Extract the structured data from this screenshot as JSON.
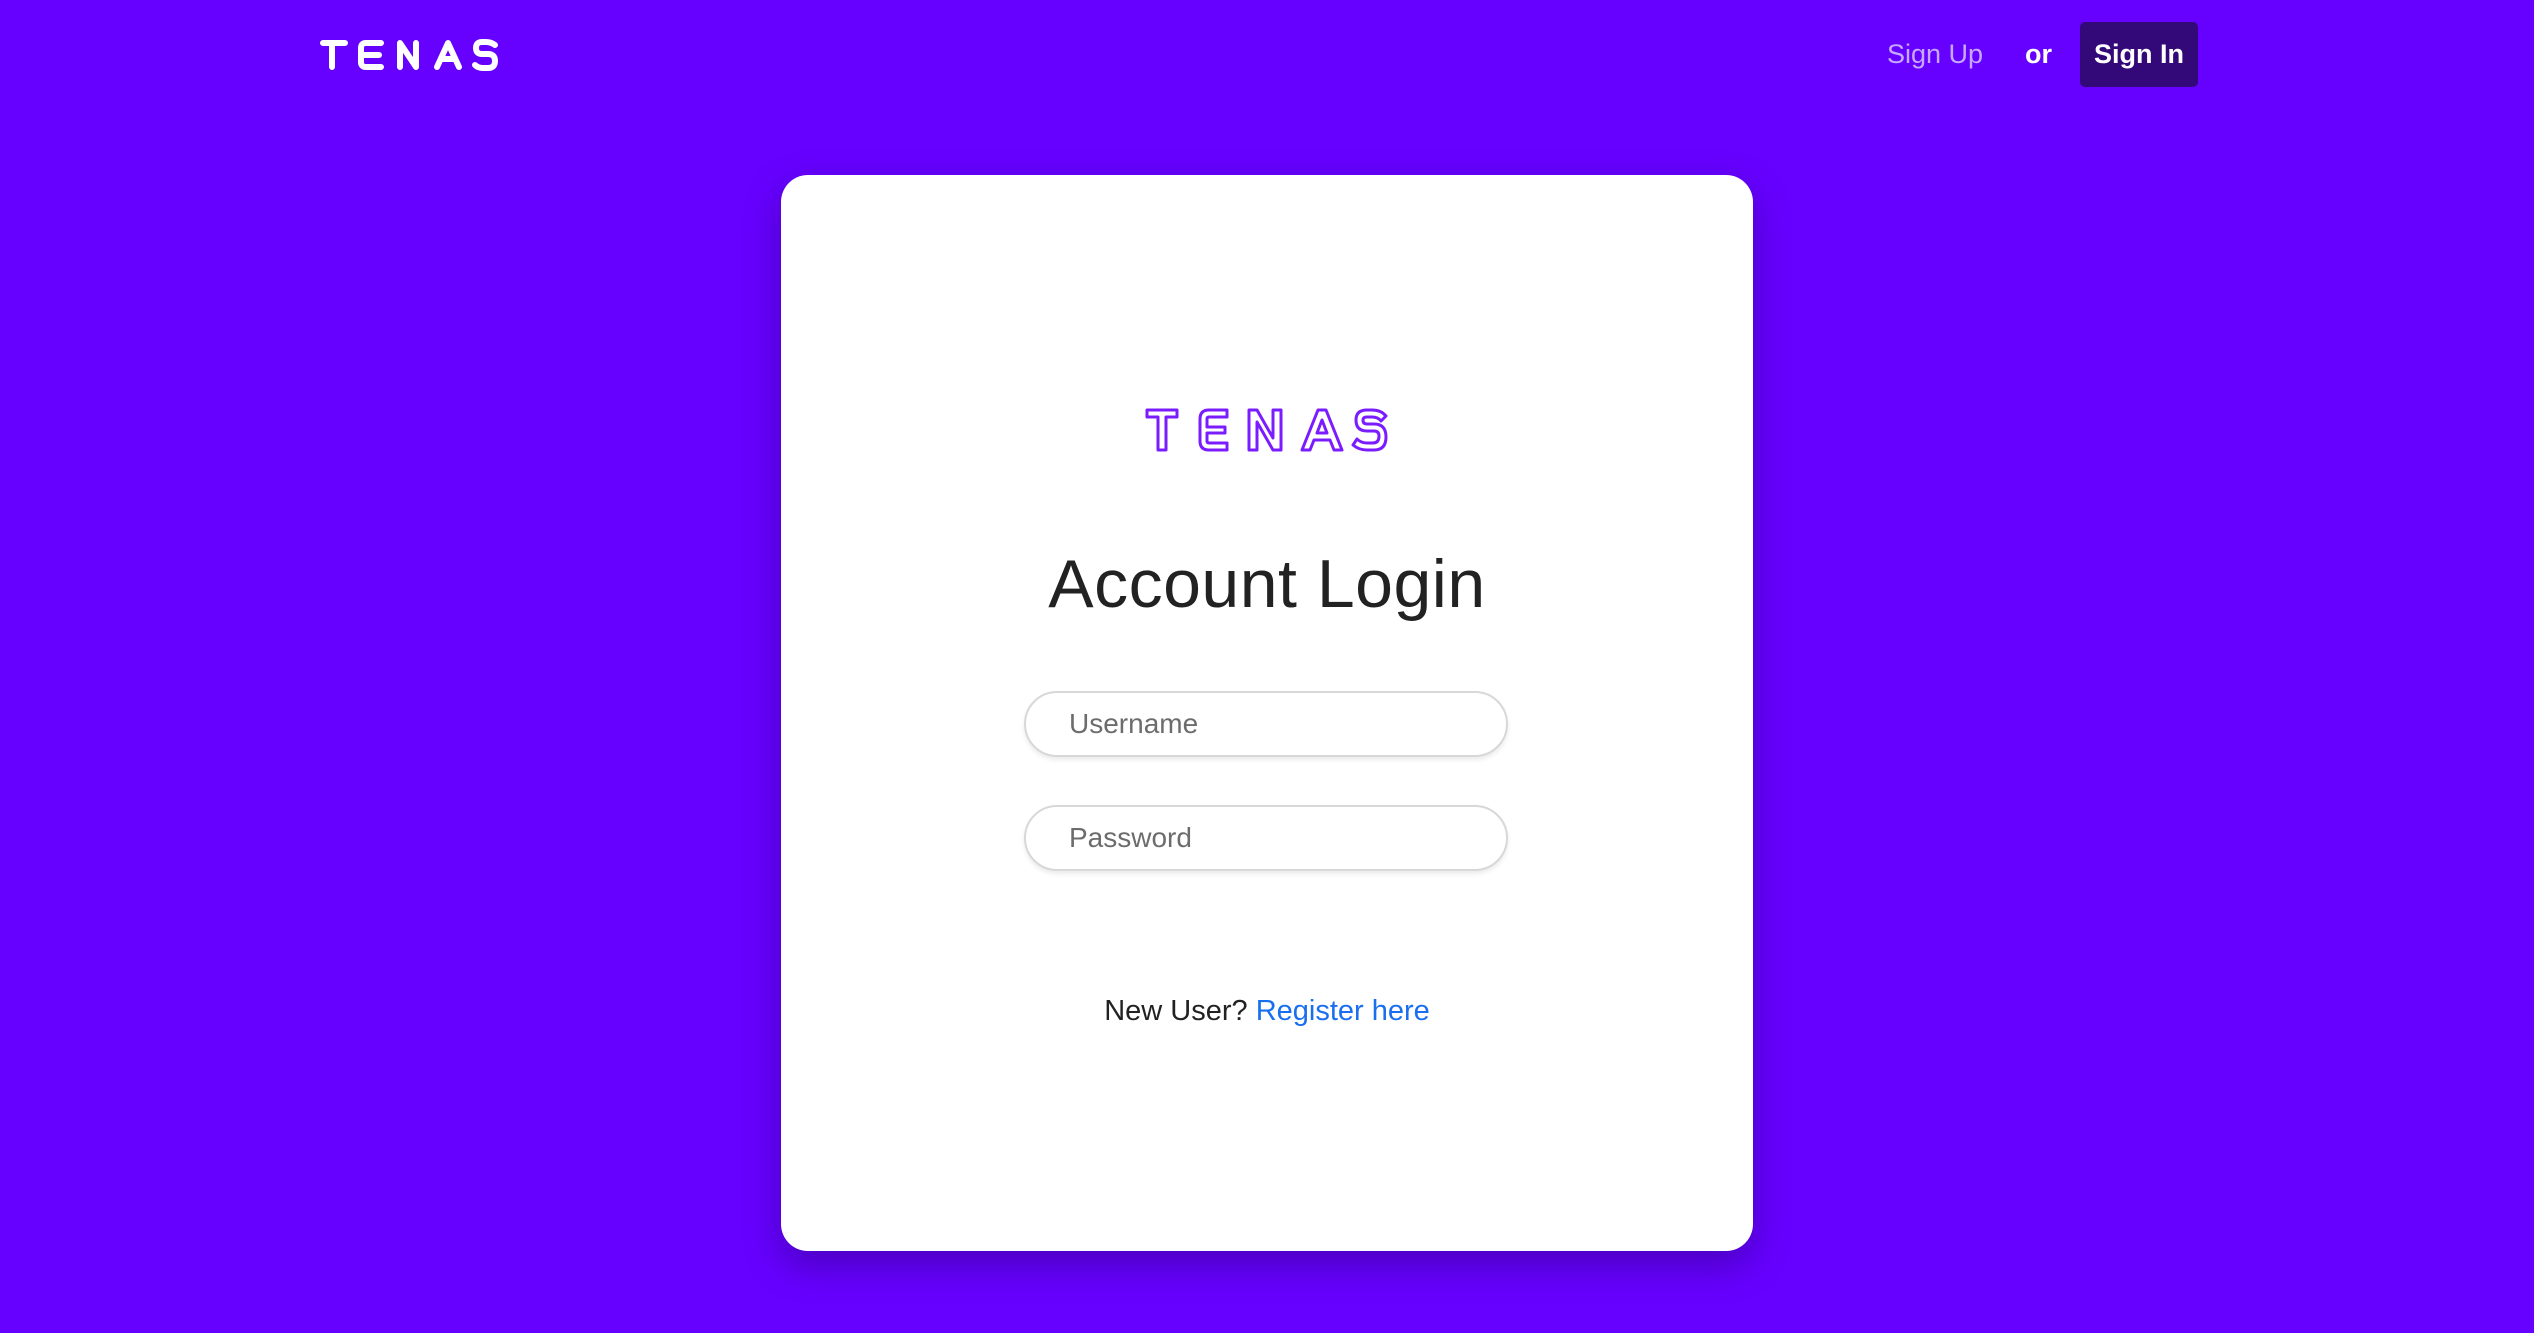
{
  "brand": {
    "logo_text": "TENAS",
    "logo_color": "#ffffff"
  },
  "nav": {
    "sign_up_label": "Sign Up",
    "or_label": "or",
    "sign_in_label": "Sign In"
  },
  "card": {
    "logo_text": "TENAS",
    "logo_color": "#7a1cff",
    "title": "Account Login",
    "username_placeholder": "Username",
    "password_placeholder": "Password",
    "register_prompt": "New User?",
    "register_link_label": "Register here"
  },
  "colors": {
    "background": "#6600ff",
    "sign_in_button": "#33097a",
    "link": "#1a6ff0"
  }
}
